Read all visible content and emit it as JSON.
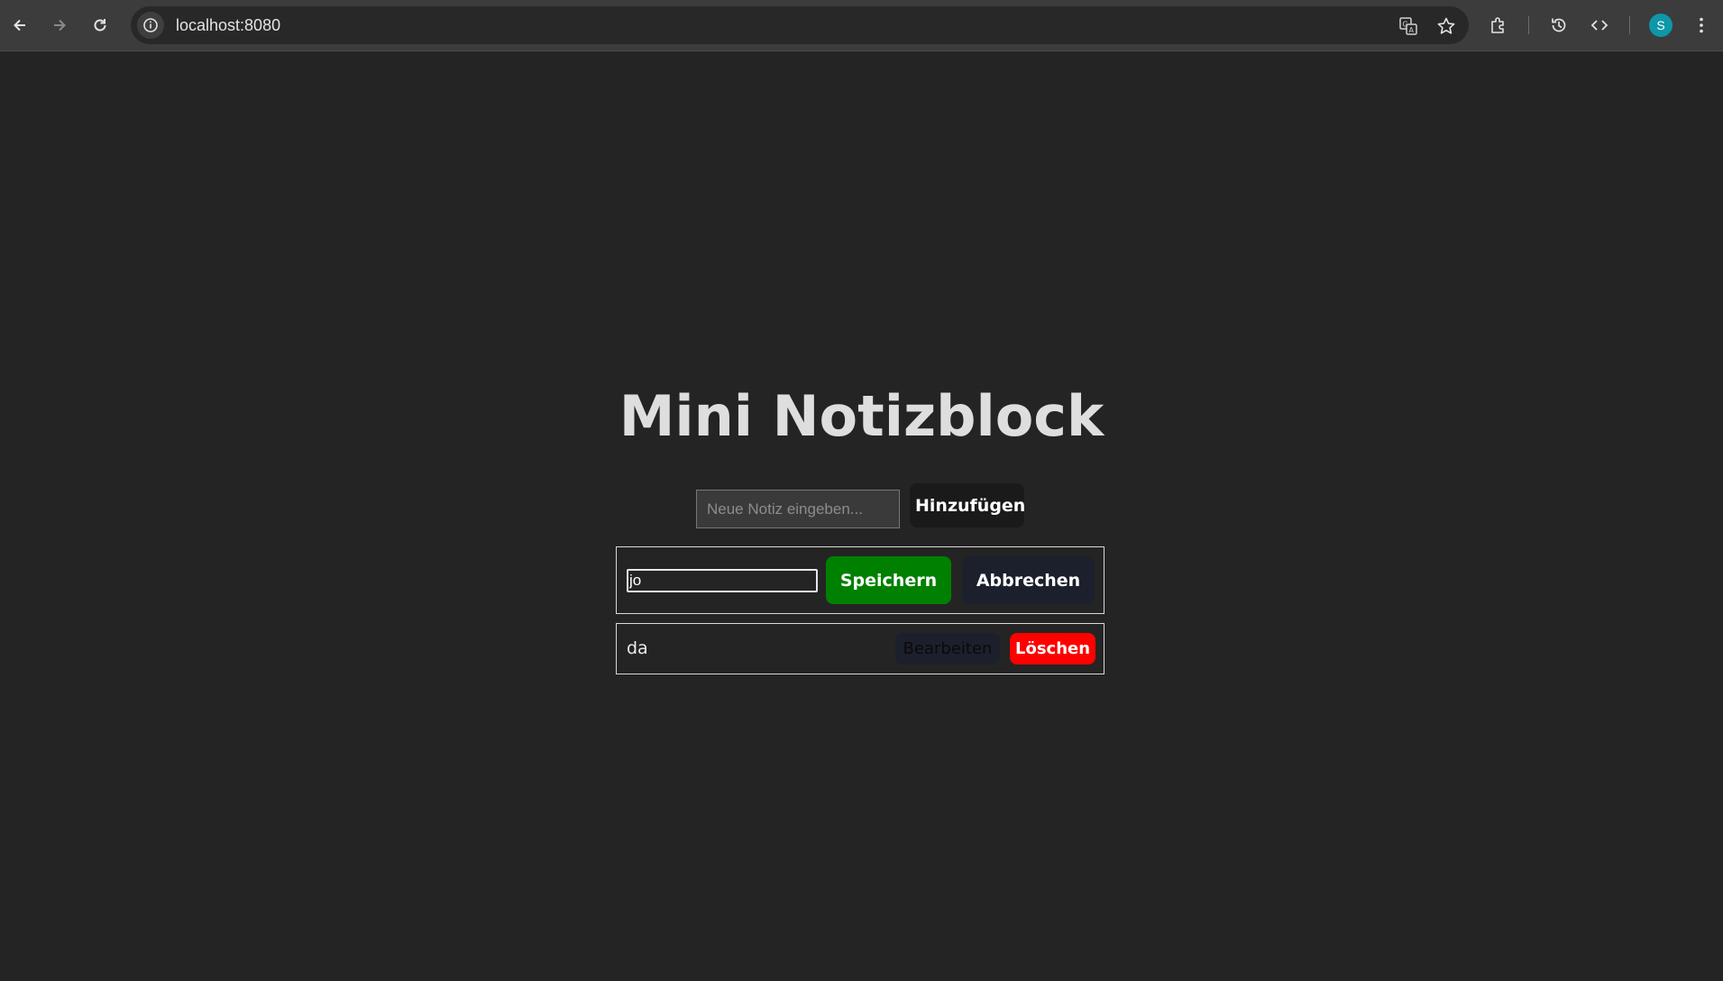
{
  "browser": {
    "url": "localhost:8080",
    "avatar_letter": "S",
    "avatar_color": "#0d97a8",
    "icons": [
      "back-icon",
      "forward-icon",
      "reload-icon",
      "site-info-icon",
      "translate-icon",
      "bookmark-star-icon",
      "extensions-icon",
      "history-icon",
      "devtools-code-icon",
      "menu-dots-icon"
    ]
  },
  "app": {
    "title": "Mini Notizblock",
    "new_note": {
      "placeholder": "Neue Notiz eingeben...",
      "value": "",
      "add_label": "Hinzufügen"
    },
    "notes": [
      {
        "mode": "edit",
        "edit_value": "jo",
        "save_label": "Speichern",
        "cancel_label": "Abbrechen"
      },
      {
        "mode": "view",
        "text": "da",
        "edit_label": "Bearbeiten",
        "delete_label": "Löschen"
      }
    ]
  },
  "colors": {
    "background": "#242424",
    "save": "#008000",
    "delete": "#ff0000",
    "dark_button": "#1b202c"
  }
}
